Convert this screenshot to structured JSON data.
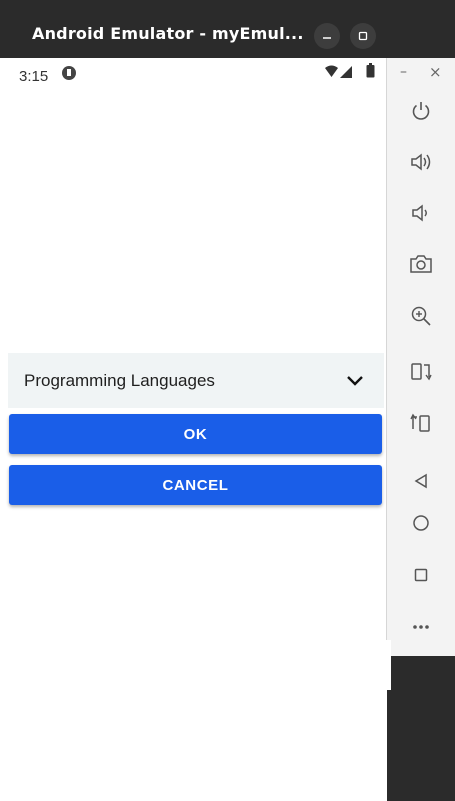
{
  "window": {
    "title": "Android Emulator - myEmul...",
    "colors": {
      "titlebar": "#2b2b2b",
      "accent": "#1a5ee8"
    }
  },
  "statusbar": {
    "time": "3:15",
    "icons": [
      "notification-icon",
      "wifi-icon",
      "signal-icon",
      "battery-icon"
    ]
  },
  "spinner": {
    "selected": "Programming Languages"
  },
  "buttons": {
    "ok_label": "OK",
    "cancel_label": "CANCEL"
  },
  "toolbar": {
    "minimize_label": "–",
    "close_label": "×",
    "items": [
      "power-icon",
      "volume-up-icon",
      "volume-down-icon",
      "camera-icon",
      "zoom-icon",
      "rotate-left-icon",
      "rotate-right-icon",
      "back-icon",
      "home-icon",
      "overview-icon",
      "more-icon"
    ]
  }
}
